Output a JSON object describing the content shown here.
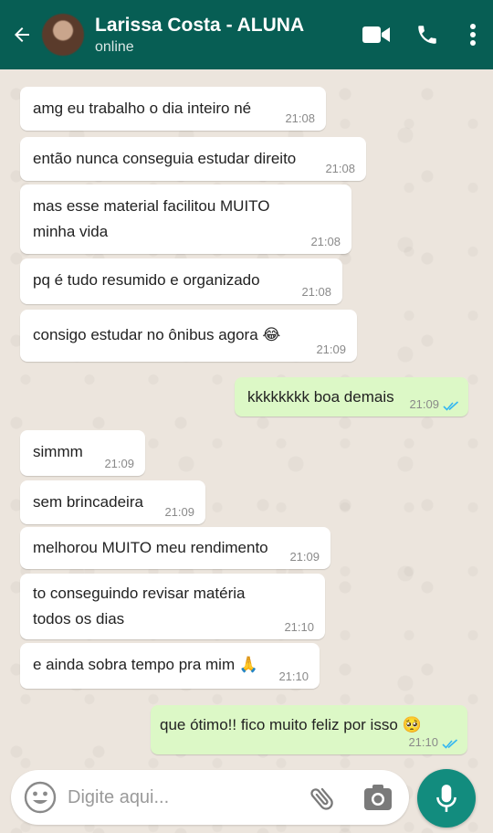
{
  "header": {
    "contact_name": "Larissa Costa - ALUNA",
    "status": "online",
    "icons": [
      "back-arrow-icon",
      "video-call-icon",
      "phone-icon",
      "more-vert-icon"
    ]
  },
  "messages": [
    {
      "dir": "in",
      "text": "amg eu trabalho o dia inteiro né",
      "time": "21:08"
    },
    {
      "dir": "in",
      "text": "então nunca conseguia estudar direito",
      "time": "21:08"
    },
    {
      "dir": "in",
      "text": "mas esse material facilitou MUITO\nminha vida",
      "time": "21:08"
    },
    {
      "dir": "in",
      "text": "pq é tudo resumido e organizado",
      "time": "21:08"
    },
    {
      "dir": "in",
      "text": "consigo estudar no ônibus agora 😂",
      "time": "21:09"
    },
    {
      "dir": "out",
      "text": "kkkkkkkk boa demais",
      "time": "21:09",
      "status": "read"
    },
    {
      "dir": "in",
      "text": "simmm",
      "time": "21:09"
    },
    {
      "dir": "in",
      "text": "sem brincadeira",
      "time": "21:09"
    },
    {
      "dir": "in",
      "text": "melhorou MUITO meu rendimento",
      "time": "21:09"
    },
    {
      "dir": "in",
      "text": "to conseguindo revisar matéria\ntodos os dias",
      "time": "21:10"
    },
    {
      "dir": "in",
      "text": "e ainda sobra tempo pra mim 🙏",
      "time": "21:10"
    },
    {
      "dir": "out",
      "text": "que ótimo!! fico muito feliz por isso 🥺",
      "time": "21:10",
      "status": "read"
    }
  ],
  "composer": {
    "placeholder": "Digite aqui...",
    "icons": [
      "emoji-icon",
      "attach-icon",
      "camera-icon",
      "mic-icon"
    ]
  },
  "colors": {
    "header": "#075e54",
    "incoming_bubble": "#ffffff",
    "outgoing_bubble": "#dcf8c6",
    "read_ticks": "#34b7f1",
    "mic_button": "#128c7e",
    "wallpaper": "#ece5dd"
  }
}
